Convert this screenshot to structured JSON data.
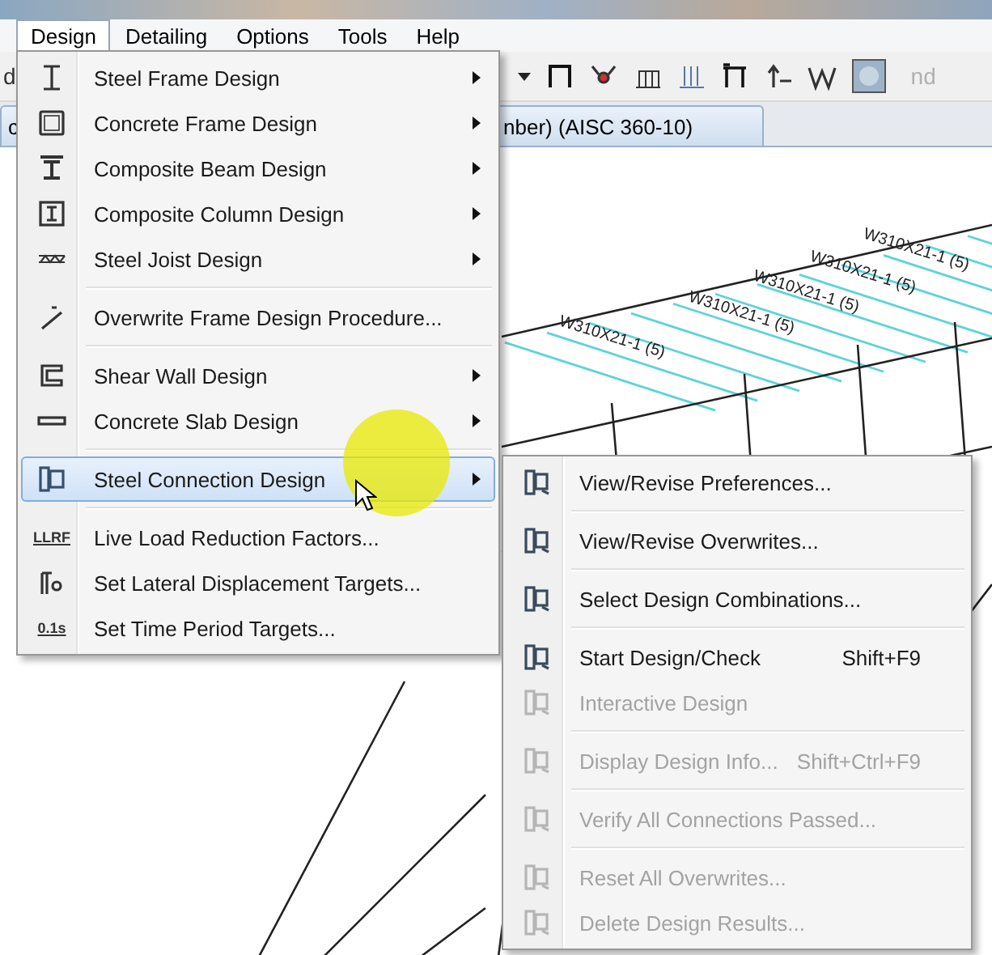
{
  "menubar": [
    {
      "label": "Design",
      "selected": true
    },
    {
      "label": "Detailing",
      "selected": false
    },
    {
      "label": "Options",
      "selected": false
    },
    {
      "label": "Tools",
      "selected": false
    },
    {
      "label": "Help",
      "selected": false
    }
  ],
  "toolbar": {
    "left_text": "d",
    "right_text": "nd"
  },
  "tab": {
    "left_text": "c",
    "label": "nber)  (AISC 360-10)"
  },
  "design_menu": [
    {
      "kind": "item",
      "label": "Steel Frame Design",
      "submenu": true,
      "selected": false
    },
    {
      "kind": "item",
      "label": "Concrete Frame Design",
      "submenu": true,
      "selected": false
    },
    {
      "kind": "item",
      "label": "Composite Beam Design",
      "submenu": true,
      "selected": false
    },
    {
      "kind": "item",
      "label": "Composite Column Design",
      "submenu": true,
      "selected": false
    },
    {
      "kind": "item",
      "label": "Steel Joist Design",
      "submenu": true,
      "selected": false
    },
    {
      "kind": "separator"
    },
    {
      "kind": "item",
      "label": "Overwrite Frame Design Procedure...",
      "submenu": false,
      "selected": false
    },
    {
      "kind": "separator"
    },
    {
      "kind": "item",
      "label": "Shear Wall Design",
      "submenu": true,
      "selected": false
    },
    {
      "kind": "item",
      "label": "Concrete Slab Design",
      "submenu": true,
      "selected": false
    },
    {
      "kind": "separator"
    },
    {
      "kind": "item",
      "label": "Steel Connection Design",
      "submenu": true,
      "selected": true
    },
    {
      "kind": "separator"
    },
    {
      "kind": "item",
      "label": "Live Load Reduction Factors...",
      "submenu": false,
      "selected": false,
      "icon_text": "LLRF"
    },
    {
      "kind": "item",
      "label": "Set Lateral Displacement Targets...",
      "submenu": false,
      "selected": false
    },
    {
      "kind": "item",
      "label": "Set Time Period Targets...",
      "submenu": false,
      "selected": false,
      "icon_text": "0.1s"
    }
  ],
  "connection_submenu": [
    {
      "kind": "item",
      "label": "View/Revise Preferences...",
      "disabled": false
    },
    {
      "kind": "separator"
    },
    {
      "kind": "item",
      "label": "View/Revise Overwrites...",
      "disabled": false
    },
    {
      "kind": "separator"
    },
    {
      "kind": "item",
      "label": "Select Design Combinations...",
      "disabled": false
    },
    {
      "kind": "separator"
    },
    {
      "kind": "item",
      "label": "Start Design/Check",
      "shortcut": "Shift+F9",
      "disabled": false
    },
    {
      "kind": "item",
      "label": "Interactive Design",
      "disabled": true
    },
    {
      "kind": "separator"
    },
    {
      "kind": "item",
      "label": "Display Design Info...",
      "shortcut": "Shift+Ctrl+F9",
      "disabled": true
    },
    {
      "kind": "separator"
    },
    {
      "kind": "item",
      "label": "Verify All Connections Passed...",
      "disabled": true
    },
    {
      "kind": "separator"
    },
    {
      "kind": "item",
      "label": "Reset All Overwrites...",
      "disabled": true
    },
    {
      "kind": "item",
      "label": "Delete Design Results...",
      "disabled": true
    }
  ],
  "model_labels": [
    "W310X21-1 (5)",
    "W310X21-1 (5)",
    "W310X21-1 (5)",
    "W310X21-1 (5)",
    "W310X21-1 (5)"
  ]
}
